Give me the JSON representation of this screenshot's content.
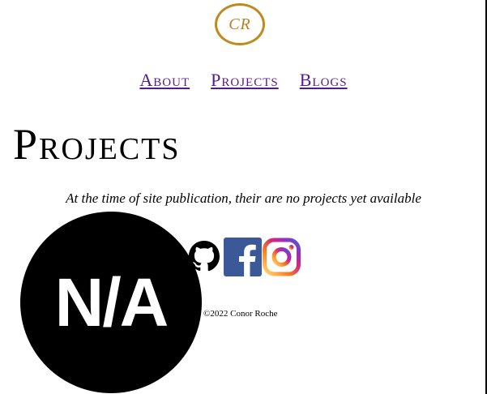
{
  "header": {
    "logo_text": "CR"
  },
  "nav": {
    "items": [
      {
        "label": "About"
      },
      {
        "label": "Projects"
      },
      {
        "label": "Blogs"
      }
    ]
  },
  "main": {
    "title": "Projects",
    "notice": "At the time of site publication, their are no projects yet available",
    "placeholder_image_text": "N/A"
  },
  "social": {
    "icons": [
      "github-icon",
      "facebook-icon",
      "instagram-icon"
    ]
  },
  "footer": {
    "copyright": "©2022 Conor Roche"
  },
  "colors": {
    "link": "#551a8b",
    "logo_gold": "#c08a1e",
    "facebook_blue": "#3b5998"
  }
}
